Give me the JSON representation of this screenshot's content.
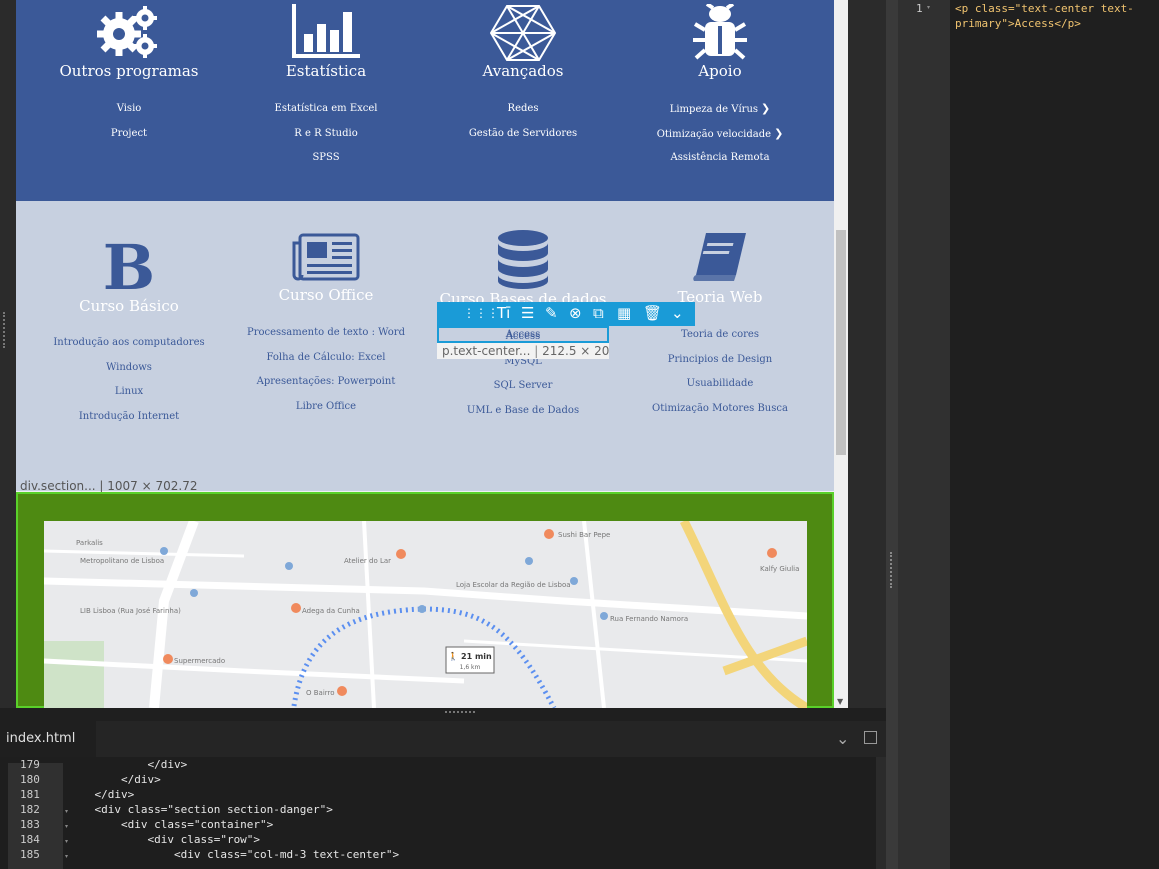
{
  "preview": {
    "blue_columns": [
      {
        "title": "Outros programas",
        "items": [
          "Visio",
          "Project"
        ]
      },
      {
        "title": "Estatística",
        "items": [
          "Estatística em  Excel",
          "R e R Studio",
          "SPSS"
        ]
      },
      {
        "title": "Avançados",
        "items": [
          "Redes",
          "Gestão de Servidores"
        ]
      },
      {
        "title": "Apoio",
        "items": [
          "Limpeza de Vírus",
          "Otimização velocidade",
          "Assistência Remota"
        ]
      }
    ],
    "grey_columns": [
      {
        "title": "Curso Básico",
        "items": [
          "Introdução aos computadores",
          "Windows",
          "Linux",
          "Introdução Internet"
        ]
      },
      {
        "title": "Curso Office",
        "items": [
          "Processamento de texto : Word",
          "Folha de Cálculo: Excel",
          "Apresentações: Powerpoint",
          "Libre Office"
        ]
      },
      {
        "title": "Curso Bases de dados",
        "items": [
          "Access",
          "MySQL",
          "SQL Server",
          "UML e Base de Dados"
        ]
      },
      {
        "title": "Teoria Web",
        "items": [
          "Teoria de cores",
          "Principios de Design",
          "Usuabilidade",
          "Otimização Motores Busca"
        ]
      }
    ],
    "section_label": "div.section... | 1007 × 702.72",
    "selection_label": "p.text-center...",
    "selection_size": "212.5 × 20",
    "map": {
      "labels": [
        "Parkalis",
        "Metropolitano de Lisboa",
        "Atelier do Lar",
        "LIB Lisboa (Rua José Farinha)",
        "Loja Escolar da Região de Lisboa",
        "Adega da Cunha",
        "Supermercado",
        "O Bairro",
        "Rua Fernando Namora",
        "Sushi Bar Pepe",
        "Kalfy Giulia"
      ],
      "route_time": "21 min",
      "route_distance": "1,6 km"
    }
  },
  "right_editor": {
    "line_number": "1",
    "code_line1": "<p class=\"text-center text-",
    "code_line2": "primary\">Access</p>"
  },
  "bottom_editor": {
    "tab_label": "index.html",
    "lines": [
      {
        "n": "179",
        "code": "            </div>"
      },
      {
        "n": "180",
        "code": "        </div>"
      },
      {
        "n": "181",
        "code": "    </div>"
      },
      {
        "n": "182",
        "code": "    <div class=\"section section-danger\">"
      },
      {
        "n": "183",
        "code": "        <div class=\"container\">"
      },
      {
        "n": "184",
        "code": "            <div class=\"row\">"
      },
      {
        "n": "185",
        "code": "                <div class=\"col-md-3 text-center\">"
      }
    ]
  },
  "colors": {
    "blue_section": "#3b5998",
    "grey_section": "#c7d0e0",
    "toolbar": "#1a9bd7",
    "map_frame": "#4e8a12"
  }
}
